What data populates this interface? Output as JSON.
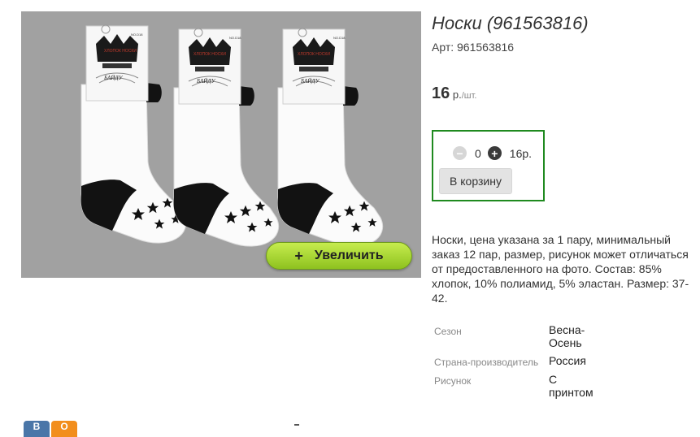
{
  "product": {
    "title": "Носки (961563816)",
    "article": "Арт: 961563816",
    "price_value": "16",
    "price_currency": " р.",
    "price_unit": "/шт.",
    "quantity": "0",
    "sum": "16р.",
    "add_to_cart_label": "В корзину",
    "zoom_plus": "+",
    "zoom_label": "Увеличить",
    "description": "Носки, цена указана за 1 пару, минимальный заказ 12 пар, размер, рисунок может отличаться от предоставленного на фото. Состав: 85% хлопок, 10% полиамид, 5% эластан. Размер: 37-42.",
    "properties": [
      {
        "label": "Сезон",
        "value": "Весна-Осень"
      },
      {
        "label": "Страна-производитель",
        "value": "Россия"
      },
      {
        "label": "Рисунок",
        "value": "С принтом"
      }
    ]
  },
  "image": {
    "label_line1": "ХЛОПОК НОСКИ",
    "label_line2": "NO.D18",
    "brand_text": "БАЙДУ"
  },
  "share": {
    "vk": "В",
    "ok": "О"
  },
  "colors": {
    "photo_bg": "#a1a1a1",
    "cart_border": "#1f8a1f",
    "zoom_button": "#9ccd2a",
    "vk": "#4a76a8",
    "ok": "#f28e1c"
  }
}
